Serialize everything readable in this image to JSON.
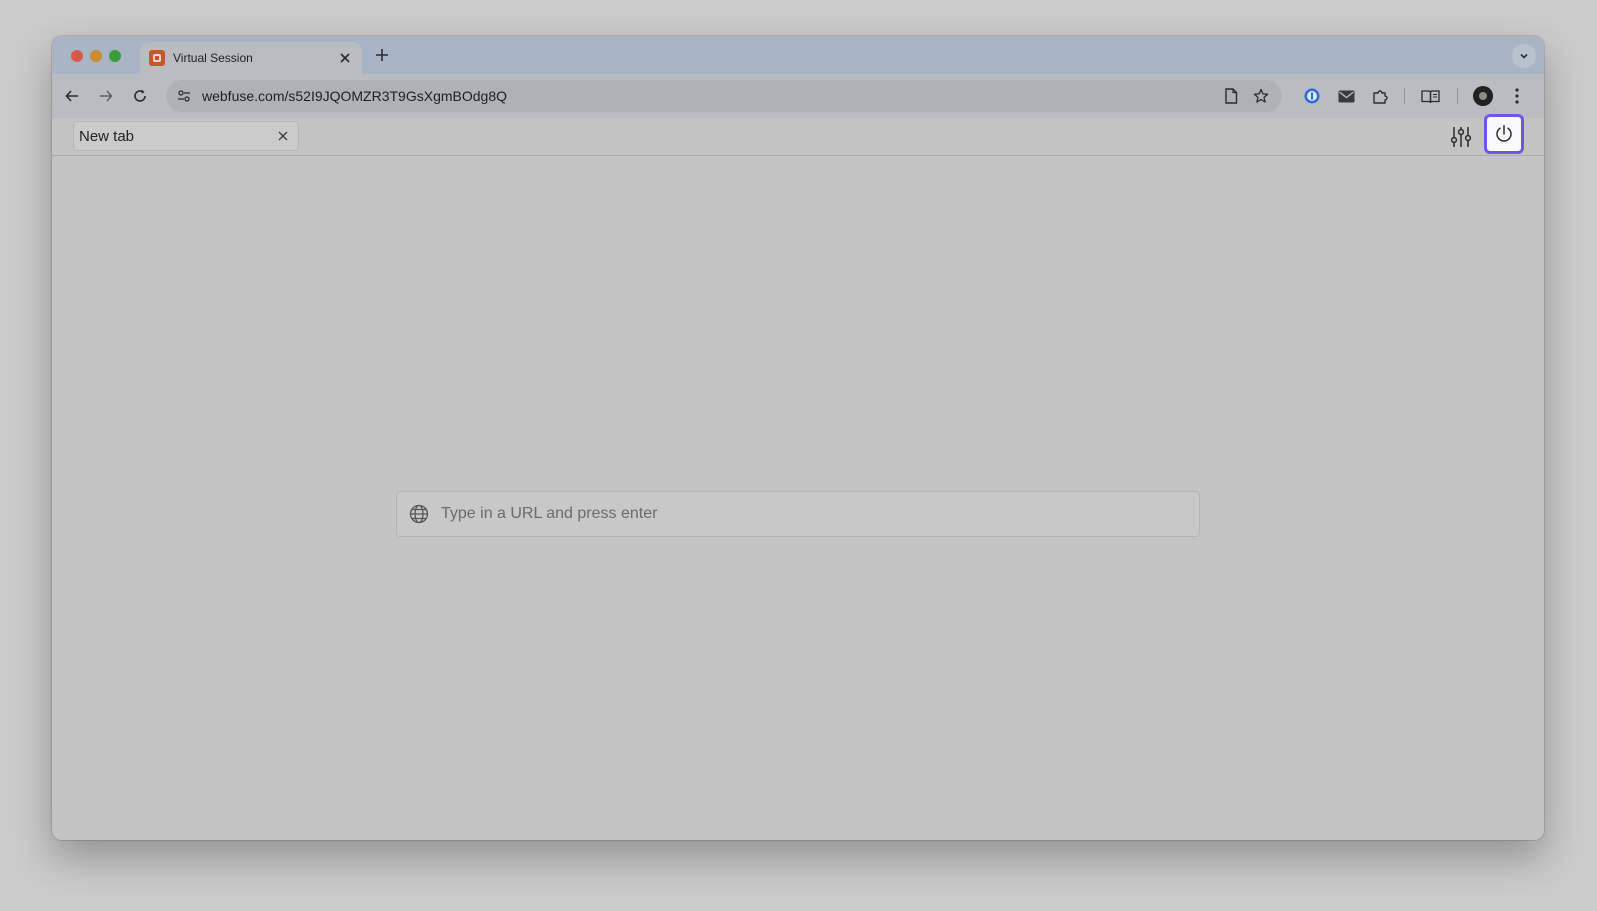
{
  "browser": {
    "tab": {
      "title": "Virtual Session",
      "favicon": "app-favicon-icon",
      "close_icon": "close-icon"
    },
    "new_tab_icon": "plus-icon",
    "tab_search_icon": "chevron-down-icon",
    "nav": {
      "back_icon": "arrow-left-icon",
      "forward_icon": "arrow-right-icon",
      "reload_icon": "reload-icon"
    },
    "omnibox": {
      "url": "webfuse.com/s52I9JQOMZR3T9GsXgmBOdg8Q",
      "site_info_icon": "tune-icon",
      "page_icon": "document-icon",
      "bookmark_icon": "star-icon"
    },
    "extensions": [
      "password-manager-icon",
      "mail-icon",
      "puzzle-icon",
      "reading-mode-icon"
    ],
    "profile_icon": "avatar-icon",
    "menu_icon": "more-vertical-icon",
    "colors": {
      "titlebar": "#a9b4c4",
      "toolbar": "#b9bcc1",
      "omnibox": "#aeb1b6"
    }
  },
  "session": {
    "tab": {
      "label": "New tab",
      "close_icon": "close-icon"
    },
    "settings_icon": "sliders-icon",
    "power_icon": "power-icon",
    "highlight_color": "#6e57e6"
  },
  "content": {
    "url_bar": {
      "placeholder": "Type in a URL and press enter",
      "value": "",
      "icon": "globe-icon"
    },
    "background": "#c4c4c4"
  }
}
